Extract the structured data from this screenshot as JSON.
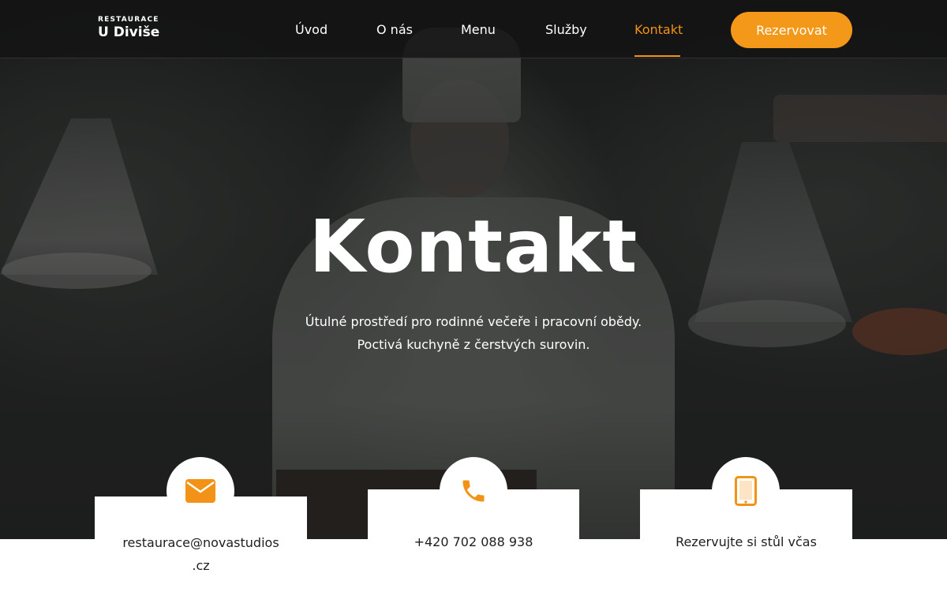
{
  "brand": {
    "small_label": "RESTAURACE",
    "name": "U Diviše"
  },
  "nav": {
    "items": [
      {
        "label": "Úvod",
        "active": false
      },
      {
        "label": "O nás",
        "active": false
      },
      {
        "label": "Menu",
        "active": false
      },
      {
        "label": "Služby",
        "active": false
      },
      {
        "label": "Kontakt",
        "active": true
      }
    ],
    "cta_label": "Rezervovat"
  },
  "hero": {
    "title": "Kontakt",
    "subtitle_line1": "Útulné prostředí pro rodinné večeře i pracovní obědy.",
    "subtitle_line2": "Poctivá kuchyně z čerstvých surovin."
  },
  "contact_cards": [
    {
      "icon": "envelope-icon",
      "text_line1": "restaurace@novastudios",
      "text_line2": ".cz"
    },
    {
      "icon": "phone-icon",
      "text": "+420 702 088 938"
    },
    {
      "icon": "tablet-icon",
      "text": "Rezervujte si stůl včas"
    }
  ],
  "colors": {
    "accent": "#f29318",
    "header_bg": "#141414",
    "text_dark": "#1e1e1e",
    "white": "#ffffff"
  }
}
